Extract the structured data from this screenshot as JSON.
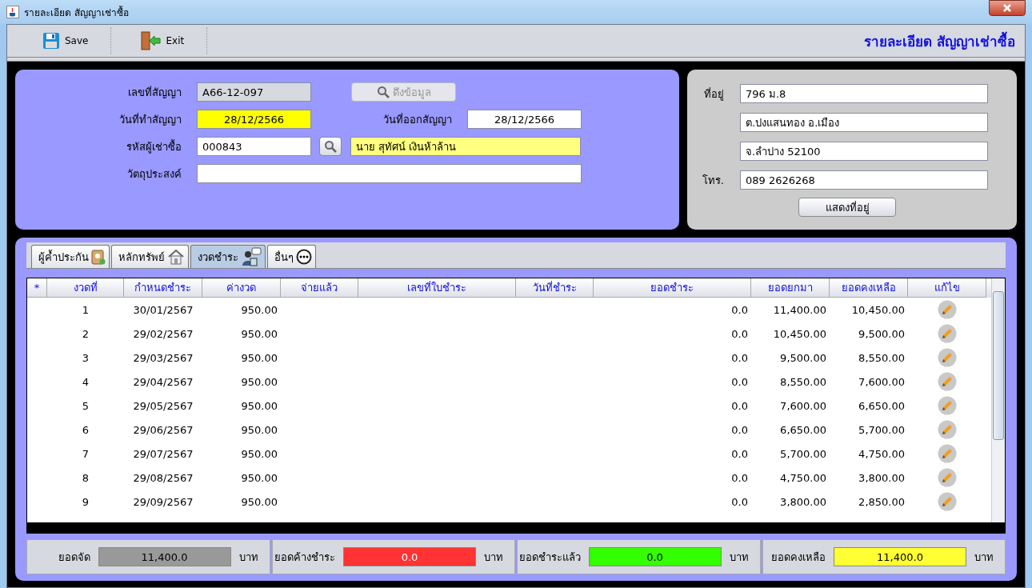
{
  "window": {
    "title": "รายละเอียด สัญญาเช่าซื้อ"
  },
  "toolbar": {
    "buttons": [
      {
        "kind": "save",
        "label": "Save"
      },
      {
        "kind": "exit",
        "label": "Exit"
      }
    ],
    "heading": "รายละเอียด สัญญาเช่าซื้อ"
  },
  "contract": {
    "contract_no": {
      "label": "เลขที่สัญญา",
      "value": "A66-12-097",
      "disabled": true
    },
    "fetch_button": {
      "label": "ดึงข้อมูล",
      "disabled": true
    },
    "contract_date": {
      "label": "วันที่ทำสัญญา",
      "value": "28/12/2566",
      "highlighted": true
    },
    "issue_date": {
      "label": "วันที่ออกสัญญา",
      "value": "28/12/2566",
      "highlighted": false
    },
    "customer_code": {
      "label": "รหัสผู้เช่าซื้อ",
      "value": "000843",
      "highlighted": false
    },
    "customer_name": {
      "value": "นาย สุทัศน์ เงินห้าล้าน",
      "highlighted": true
    },
    "purpose": {
      "label": "วัตถุประสงค์"
    }
  },
  "address": {
    "address_label": "ที่อยู่",
    "lines": [
      "796 ม.8",
      "ต.ปงแสนทอง อ.เมือง",
      "จ.ลำปาง 52100"
    ],
    "phone_label": "โทร.",
    "phone": "089 2626268",
    "button": "แสดงที่อยู่"
  },
  "tabs": [
    {
      "kind": "guarantor",
      "label": "ผู้ค้ำประกัน",
      "selected": false
    },
    {
      "kind": "collateral",
      "label": "หลักทรัพย์",
      "selected": false
    },
    {
      "kind": "installments",
      "label": "งวดชำระ",
      "selected": true
    },
    {
      "kind": "other",
      "label": "อื่นๆ",
      "selected": false
    }
  ],
  "table": {
    "columns": [
      "*",
      "งวดที่",
      "กำหนดชำระ",
      "ค่างวด",
      "จ่ายแล้ว",
      "เลขที่ใบชำระ",
      "วันที่ชำระ",
      "ยอดชำระ",
      "ยอดยกมา",
      "ยอดคงเหลือ",
      "แก้ไข"
    ],
    "rows": [
      {
        "installment": "1",
        "due_date": "30/01/2567",
        "amount": "950.00",
        "payment": "0.0",
        "brought_forward": "11,400.00",
        "balance": "10,450.00"
      },
      {
        "installment": "2",
        "due_date": "29/02/2567",
        "amount": "950.00",
        "payment": "0.0",
        "brought_forward": "10,450.00",
        "balance": "9,500.00"
      },
      {
        "installment": "3",
        "due_date": "29/03/2567",
        "amount": "950.00",
        "payment": "0.0",
        "brought_forward": "9,500.00",
        "balance": "8,550.00"
      },
      {
        "installment": "4",
        "due_date": "29/04/2567",
        "amount": "950.00",
        "payment": "0.0",
        "brought_forward": "8,550.00",
        "balance": "7,600.00"
      },
      {
        "installment": "5",
        "due_date": "29/05/2567",
        "amount": "950.00",
        "payment": "0.0",
        "brought_forward": "7,600.00",
        "balance": "6,650.00"
      },
      {
        "installment": "6",
        "due_date": "29/06/2567",
        "amount": "950.00",
        "payment": "0.0",
        "brought_forward": "6,650.00",
        "balance": "5,700.00"
      },
      {
        "installment": "7",
        "due_date": "29/07/2567",
        "amount": "950.00",
        "payment": "0.0",
        "brought_forward": "5,700.00",
        "balance": "4,750.00"
      },
      {
        "installment": "8",
        "due_date": "29/08/2567",
        "amount": "950.00",
        "payment": "0.0",
        "brought_forward": "4,750.00",
        "balance": "3,800.00"
      },
      {
        "installment": "9",
        "due_date": "29/09/2567",
        "amount": "950.00",
        "payment": "0.0",
        "brought_forward": "3,800.00",
        "balance": "2,850.00"
      }
    ]
  },
  "summary": [
    {
      "label": "ยอดจัด",
      "value": "11,400.0",
      "unit": "บาท",
      "color": "#999999"
    },
    {
      "label": "ยอดค้างชำระ",
      "value": "0.0",
      "unit": "บาท",
      "color": "#ff3333"
    },
    {
      "label": "ยอดชำระแล้ว",
      "value": "0.0",
      "unit": "บาท",
      "color": "#33ff00"
    },
    {
      "label": "ยอดคงเหลือ",
      "value": "11,400.0",
      "unit": "บาท",
      "color": "#ffff33"
    }
  ]
}
